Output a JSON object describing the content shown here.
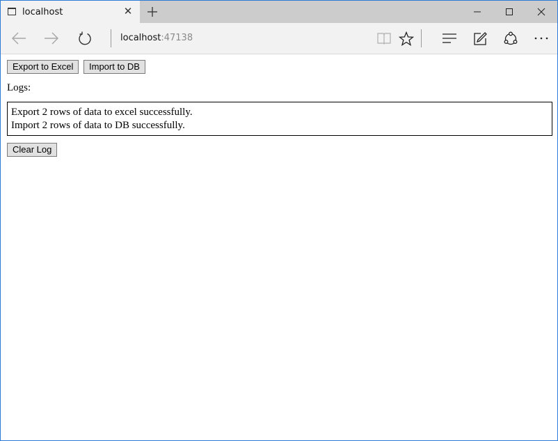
{
  "browser": {
    "tab": {
      "title": "localhost",
      "page_icon": "page-icon",
      "close_icon": "close-icon"
    },
    "new_tab_icon": "plus-icon",
    "window_controls": [
      "minimize-icon",
      "maximize-icon",
      "close-icon"
    ],
    "nav": {
      "back_icon": "back-arrow-icon",
      "forward_icon": "forward-arrow-icon",
      "refresh_icon": "refresh-icon",
      "address_host": "localhost",
      "address_port": ":47138",
      "reading_view_icon": "book-icon",
      "favorite_icon": "star-icon",
      "hub_icon": "hub-lines-icon",
      "notes_icon": "pen-note-icon",
      "share_icon": "share-icon",
      "more_icon": "more-icon"
    }
  },
  "page": {
    "export_button": "Export to Excel",
    "import_button": "Import to DB",
    "logs_label": "Logs:",
    "log_lines": [
      "Export 2 rows of data to excel successfully.",
      "Import 2 rows of data to DB successfully."
    ],
    "clear_button": "Clear Log"
  },
  "colors": {
    "window_border": "#2b7bd6",
    "tab_strip": "#cccccc",
    "toolbar": "#f2f2f2"
  }
}
